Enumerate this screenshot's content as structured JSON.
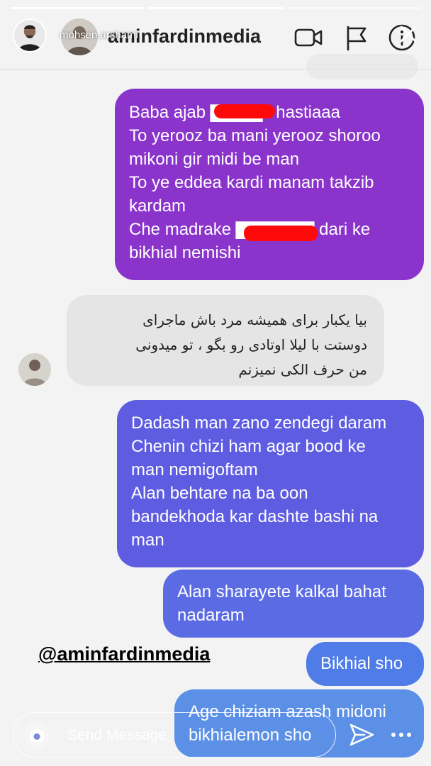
{
  "story": {
    "username": "mohsen.arshami",
    "progress_segments": 3,
    "completed_segments": 2
  },
  "dm_header": {
    "title": "aminfardinmedia",
    "icons": [
      "video-camera-icon",
      "flag-icon",
      "info-icon"
    ]
  },
  "messages": [
    {
      "id": "m1",
      "direction": "outgoing",
      "color": "#8a34cc",
      "lines": [
        "Baba ajab ▇▇▇▇ i hastiaaa",
        "To yerooz ba mani yerooz shoroo",
        "mikoni gir midi be man",
        "To ye eddea kardi manam takzib",
        "kardam",
        "Che madrake ▇▇▇▇▇▇ dari ke",
        "bikhial nemishi"
      ]
    },
    {
      "id": "m2",
      "direction": "incoming",
      "lines": [
        "بیا یکبار برای همیشه مرد باش ماجرای",
        "دوستت با لیلا اوتادی رو بگو ، تو میدونی",
        "من حرف الکی نمیزنم"
      ]
    },
    {
      "id": "m3",
      "direction": "outgoing",
      "color": "#5e5de2",
      "lines": [
        "Dadash man zano zendegi daram",
        "Chenin chizi ham agar bood ke",
        "man nemigoftam",
        "Alan behtare na ba oon",
        "bandekhoda kar dashte bashi na",
        "man"
      ]
    },
    {
      "id": "m4",
      "direction": "outgoing",
      "color": "#5a6be4",
      "lines": [
        "Alan sharayete kalkal bahat",
        "nadaram"
      ]
    },
    {
      "id": "m5",
      "direction": "outgoing",
      "color": "#4f7ce6",
      "lines": [
        "Bikhial sho"
      ]
    },
    {
      "id": "m6",
      "direction": "outgoing",
      "color": "#5088e6",
      "lines": [
        "Age chiziam azash midoni",
        "bikhialemon sho"
      ]
    }
  ],
  "watermark": "@aminfardinmedia",
  "composer": {
    "placeholder": "Send Message"
  }
}
